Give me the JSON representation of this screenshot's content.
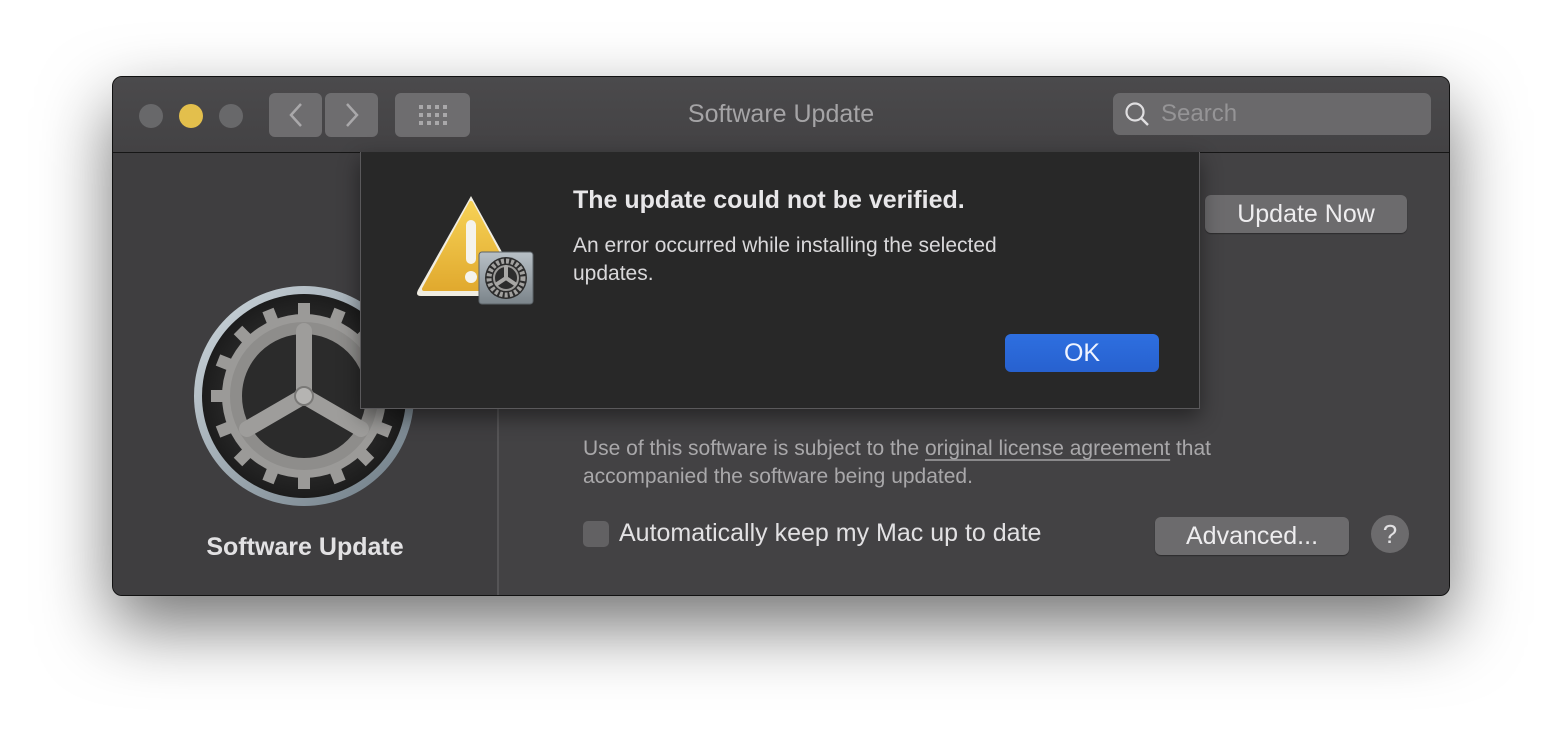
{
  "window": {
    "title": "Software Update",
    "traffic_lights": {
      "close_color": "#68686a",
      "minimize_color": "#e3bf4c",
      "zoom_color": "#68686a"
    },
    "search": {
      "placeholder": "Search",
      "value": ""
    }
  },
  "sidebar": {
    "pane_title": "Software Update",
    "icon": "gear-icon"
  },
  "content": {
    "update_now_label": "Update Now",
    "license": {
      "prefix": "Use of this software is subject to the ",
      "link_text": "original license agreement",
      "suffix": " that accompanied the software being updated."
    },
    "auto_update": {
      "label": "Automatically keep my Mac up to date",
      "checked": false
    },
    "advanced_label": "Advanced...",
    "help_label": "?"
  },
  "alert": {
    "title": "The update could not be verified.",
    "message": "An error occurred while installing the selected updates.",
    "ok_label": "OK",
    "icon": "warning-icon",
    "accent_color": "#2a67d8"
  }
}
